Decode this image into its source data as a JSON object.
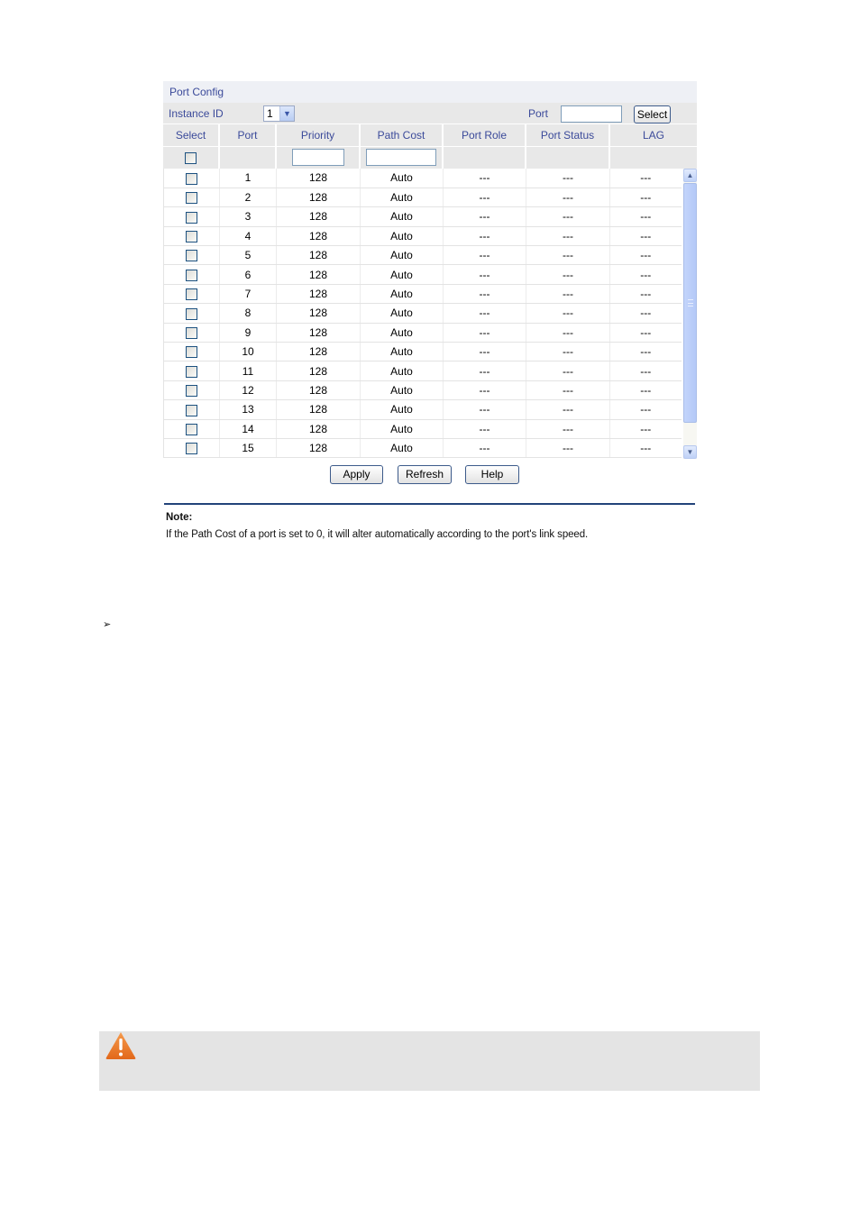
{
  "panel": {
    "title": "Port Config",
    "instance_label": "Instance ID",
    "instance_value": "1",
    "port_label": "Port",
    "port_value": "",
    "select_button": "Select"
  },
  "table": {
    "columns": [
      "Select",
      "Port",
      "Priority",
      "Path Cost",
      "Port Role",
      "Port Status",
      "LAG"
    ],
    "filter": {
      "priority": "",
      "path_cost": ""
    },
    "rows": [
      {
        "port": "1",
        "priority": "128",
        "path_cost": "Auto",
        "role": "---",
        "status": "---",
        "lag": "---",
        "selected": false
      },
      {
        "port": "2",
        "priority": "128",
        "path_cost": "Auto",
        "role": "---",
        "status": "---",
        "lag": "---",
        "selected": false
      },
      {
        "port": "3",
        "priority": "128",
        "path_cost": "Auto",
        "role": "---",
        "status": "---",
        "lag": "---",
        "selected": false
      },
      {
        "port": "4",
        "priority": "128",
        "path_cost": "Auto",
        "role": "---",
        "status": "---",
        "lag": "---",
        "selected": false
      },
      {
        "port": "5",
        "priority": "128",
        "path_cost": "Auto",
        "role": "---",
        "status": "---",
        "lag": "---",
        "selected": false
      },
      {
        "port": "6",
        "priority": "128",
        "path_cost": "Auto",
        "role": "---",
        "status": "---",
        "lag": "---",
        "selected": false
      },
      {
        "port": "7",
        "priority": "128",
        "path_cost": "Auto",
        "role": "---",
        "status": "---",
        "lag": "---",
        "selected": false
      },
      {
        "port": "8",
        "priority": "128",
        "path_cost": "Auto",
        "role": "---",
        "status": "---",
        "lag": "---",
        "selected": false
      },
      {
        "port": "9",
        "priority": "128",
        "path_cost": "Auto",
        "role": "---",
        "status": "---",
        "lag": "---",
        "selected": false
      },
      {
        "port": "10",
        "priority": "128",
        "path_cost": "Auto",
        "role": "---",
        "status": "---",
        "lag": "---",
        "selected": false
      },
      {
        "port": "11",
        "priority": "128",
        "path_cost": "Auto",
        "role": "---",
        "status": "---",
        "lag": "---",
        "selected": false
      },
      {
        "port": "12",
        "priority": "128",
        "path_cost": "Auto",
        "role": "---",
        "status": "---",
        "lag": "---",
        "selected": false
      },
      {
        "port": "13",
        "priority": "128",
        "path_cost": "Auto",
        "role": "---",
        "status": "---",
        "lag": "---",
        "selected": false
      },
      {
        "port": "14",
        "priority": "128",
        "path_cost": "Auto",
        "role": "---",
        "status": "---",
        "lag": "---",
        "selected": false
      },
      {
        "port": "15",
        "priority": "128",
        "path_cost": "Auto",
        "role": "---",
        "status": "---",
        "lag": "---",
        "selected": false
      }
    ]
  },
  "scroll": {
    "position_fraction": 0.0
  },
  "actions": {
    "apply": "Apply",
    "refresh": "Refresh",
    "help": "Help"
  },
  "note": {
    "title": "Note:",
    "text": "If the Path Cost of a port is set to 0, it will alter automatically according to the port's link speed."
  },
  "bullet": {
    "glyph": "➢"
  },
  "warning": {
    "icon": "warning-triangle-icon",
    "color": "#e8731f"
  },
  "colors": {
    "accent_text": "#3b4a9a",
    "header_bg": "#e8e8e8",
    "rule": "#23437a"
  }
}
